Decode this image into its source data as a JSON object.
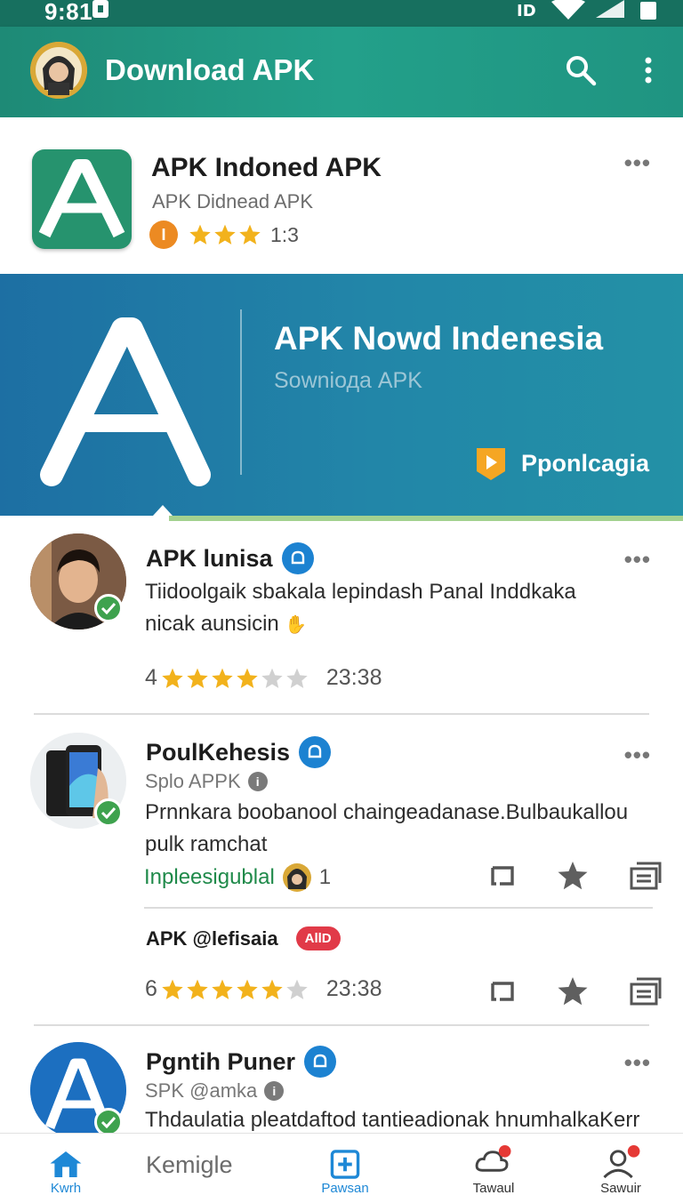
{
  "status_bar": {
    "time": "9:81"
  },
  "app_bar": {
    "title": "Download APK"
  },
  "app_header": {
    "name": "APK Indoned APK",
    "subtitle": "APK Didnead APK",
    "rating_value": "1:3",
    "stars": 3
  },
  "banner": {
    "title": "APK Nowd Indenesia",
    "subtitle": "Sowniода APK",
    "action_label": "Pponlcagia"
  },
  "posts": [
    {
      "name": "APK lunisa",
      "text_line1": "Tiidoolgaik sbakala lepindash Panal Inddkaka",
      "text_line2": "nicak aunsicin",
      "rating": "4",
      "stars": 4,
      "time": "23:38"
    },
    {
      "name": "PoulKehesis",
      "subtitle": "Splo APPK",
      "text_line1": "Prnnkara boobanool chaingeadanase.Bulbaukallou",
      "text_line2": "pulk ramchat",
      "link": "Inpleesigublal",
      "count": "1",
      "reply": {
        "name": "APK @lefisaia",
        "tag": "AllD",
        "rating": "6",
        "stars": 5,
        "time": "23:38"
      }
    },
    {
      "name": "Pgntih Puner",
      "subtitle": "SPK @amka",
      "text_line1": "Thdaulatia pleatdaftod tantieadionak hnumhalkaKerr"
    }
  ],
  "bottom_nav": {
    "items": [
      {
        "label": "Kwrh"
      },
      {
        "label": "Kemigle"
      },
      {
        "label": "Pawsan"
      },
      {
        "label": "Tawaul"
      },
      {
        "label": "Sawuir"
      }
    ]
  },
  "colors": {
    "primary": "#1f9481",
    "banner": "#1d6fa3",
    "star": "#f2b21c",
    "verified": "#1c82d1"
  }
}
